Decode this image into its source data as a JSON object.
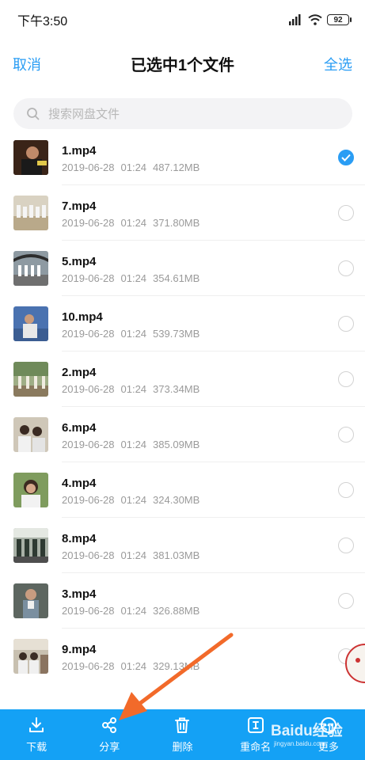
{
  "status_bar": {
    "time": "下午3:50",
    "battery": "92"
  },
  "header": {
    "cancel_label": "取消",
    "title": "已选中1个文件",
    "select_all_label": "全选"
  },
  "search": {
    "placeholder": "搜索网盘文件"
  },
  "files": [
    {
      "name": "1.mp4",
      "date": "2019-06-28",
      "time": "01:24",
      "size": "487.12MB",
      "selected": true
    },
    {
      "name": "7.mp4",
      "date": "2019-06-28",
      "time": "01:24",
      "size": "371.80MB",
      "selected": false
    },
    {
      "name": "5.mp4",
      "date": "2019-06-28",
      "time": "01:24",
      "size": "354.61MB",
      "selected": false
    },
    {
      "name": "10.mp4",
      "date": "2019-06-28",
      "time": "01:24",
      "size": "539.73MB",
      "selected": false
    },
    {
      "name": "2.mp4",
      "date": "2019-06-28",
      "time": "01:24",
      "size": "373.34MB",
      "selected": false
    },
    {
      "name": "6.mp4",
      "date": "2019-06-28",
      "time": "01:24",
      "size": "385.09MB",
      "selected": false
    },
    {
      "name": "4.mp4",
      "date": "2019-06-28",
      "time": "01:24",
      "size": "324.30MB",
      "selected": false
    },
    {
      "name": "8.mp4",
      "date": "2019-06-28",
      "time": "01:24",
      "size": "381.03MB",
      "selected": false
    },
    {
      "name": "3.mp4",
      "date": "2019-06-28",
      "time": "01:24",
      "size": "326.88MB",
      "selected": false
    },
    {
      "name": "9.mp4",
      "date": "2019-06-28",
      "time": "01:24",
      "size": "329.13MB",
      "selected": false
    }
  ],
  "toolbar": {
    "download_label": "下载",
    "share_label": "分享",
    "delete_label": "删除",
    "rename_label": "重命名",
    "more_label": "更多"
  },
  "colors": {
    "accent": "#2a9df4",
    "toolbar_bg": "#14a1f5",
    "arrow": "#f26a2a"
  },
  "watermark": {
    "brand": "Baidu经验",
    "url": "jingyan.baidu.com"
  }
}
